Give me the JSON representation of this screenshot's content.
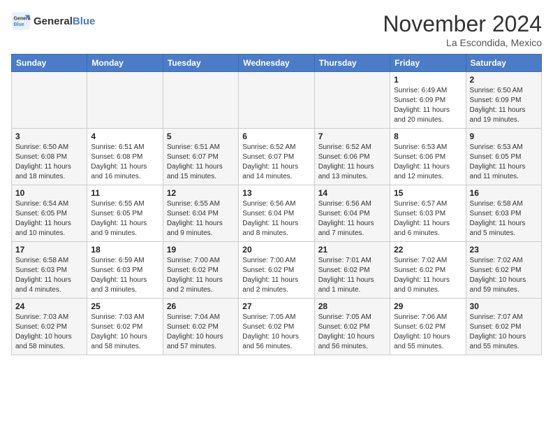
{
  "logo": {
    "line1": "General",
    "line2": "Blue"
  },
  "title": "November 2024",
  "location": "La Escondida, Mexico",
  "days_of_week": [
    "Sunday",
    "Monday",
    "Tuesday",
    "Wednesday",
    "Thursday",
    "Friday",
    "Saturday"
  ],
  "weeks": [
    [
      {
        "day": "",
        "info": ""
      },
      {
        "day": "",
        "info": ""
      },
      {
        "day": "",
        "info": ""
      },
      {
        "day": "",
        "info": ""
      },
      {
        "day": "",
        "info": ""
      },
      {
        "day": "1",
        "info": "Sunrise: 6:49 AM\nSunset: 6:09 PM\nDaylight: 11 hours and 20 minutes."
      },
      {
        "day": "2",
        "info": "Sunrise: 6:50 AM\nSunset: 6:09 PM\nDaylight: 11 hours and 19 minutes."
      }
    ],
    [
      {
        "day": "3",
        "info": "Sunrise: 6:50 AM\nSunset: 6:08 PM\nDaylight: 11 hours and 18 minutes."
      },
      {
        "day": "4",
        "info": "Sunrise: 6:51 AM\nSunset: 6:08 PM\nDaylight: 11 hours and 16 minutes."
      },
      {
        "day": "5",
        "info": "Sunrise: 6:51 AM\nSunset: 6:07 PM\nDaylight: 11 hours and 15 minutes."
      },
      {
        "day": "6",
        "info": "Sunrise: 6:52 AM\nSunset: 6:07 PM\nDaylight: 11 hours and 14 minutes."
      },
      {
        "day": "7",
        "info": "Sunrise: 6:52 AM\nSunset: 6:06 PM\nDaylight: 11 hours and 13 minutes."
      },
      {
        "day": "8",
        "info": "Sunrise: 6:53 AM\nSunset: 6:06 PM\nDaylight: 11 hours and 12 minutes."
      },
      {
        "day": "9",
        "info": "Sunrise: 6:53 AM\nSunset: 6:05 PM\nDaylight: 11 hours and 11 minutes."
      }
    ],
    [
      {
        "day": "10",
        "info": "Sunrise: 6:54 AM\nSunset: 6:05 PM\nDaylight: 11 hours and 10 minutes."
      },
      {
        "day": "11",
        "info": "Sunrise: 6:55 AM\nSunset: 6:05 PM\nDaylight: 11 hours and 9 minutes."
      },
      {
        "day": "12",
        "info": "Sunrise: 6:55 AM\nSunset: 6:04 PM\nDaylight: 11 hours and 9 minutes."
      },
      {
        "day": "13",
        "info": "Sunrise: 6:56 AM\nSunset: 6:04 PM\nDaylight: 11 hours and 8 minutes."
      },
      {
        "day": "14",
        "info": "Sunrise: 6:56 AM\nSunset: 6:04 PM\nDaylight: 11 hours and 7 minutes."
      },
      {
        "day": "15",
        "info": "Sunrise: 6:57 AM\nSunset: 6:03 PM\nDaylight: 11 hours and 6 minutes."
      },
      {
        "day": "16",
        "info": "Sunrise: 6:58 AM\nSunset: 6:03 PM\nDaylight: 11 hours and 5 minutes."
      }
    ],
    [
      {
        "day": "17",
        "info": "Sunrise: 6:58 AM\nSunset: 6:03 PM\nDaylight: 11 hours and 4 minutes."
      },
      {
        "day": "18",
        "info": "Sunrise: 6:59 AM\nSunset: 6:03 PM\nDaylight: 11 hours and 3 minutes."
      },
      {
        "day": "19",
        "info": "Sunrise: 7:00 AM\nSunset: 6:02 PM\nDaylight: 11 hours and 2 minutes."
      },
      {
        "day": "20",
        "info": "Sunrise: 7:00 AM\nSunset: 6:02 PM\nDaylight: 11 hours and 2 minutes."
      },
      {
        "day": "21",
        "info": "Sunrise: 7:01 AM\nSunset: 6:02 PM\nDaylight: 11 hours and 1 minute."
      },
      {
        "day": "22",
        "info": "Sunrise: 7:02 AM\nSunset: 6:02 PM\nDaylight: 11 hours and 0 minutes."
      },
      {
        "day": "23",
        "info": "Sunrise: 7:02 AM\nSunset: 6:02 PM\nDaylight: 10 hours and 59 minutes."
      }
    ],
    [
      {
        "day": "24",
        "info": "Sunrise: 7:03 AM\nSunset: 6:02 PM\nDaylight: 10 hours and 58 minutes."
      },
      {
        "day": "25",
        "info": "Sunrise: 7:03 AM\nSunset: 6:02 PM\nDaylight: 10 hours and 58 minutes."
      },
      {
        "day": "26",
        "info": "Sunrise: 7:04 AM\nSunset: 6:02 PM\nDaylight: 10 hours and 57 minutes."
      },
      {
        "day": "27",
        "info": "Sunrise: 7:05 AM\nSunset: 6:02 PM\nDaylight: 10 hours and 56 minutes."
      },
      {
        "day": "28",
        "info": "Sunrise: 7:05 AM\nSunset: 6:02 PM\nDaylight: 10 hours and 56 minutes."
      },
      {
        "day": "29",
        "info": "Sunrise: 7:06 AM\nSunset: 6:02 PM\nDaylight: 10 hours and 55 minutes."
      },
      {
        "day": "30",
        "info": "Sunrise: 7:07 AM\nSunset: 6:02 PM\nDaylight: 10 hours and 55 minutes."
      }
    ]
  ]
}
